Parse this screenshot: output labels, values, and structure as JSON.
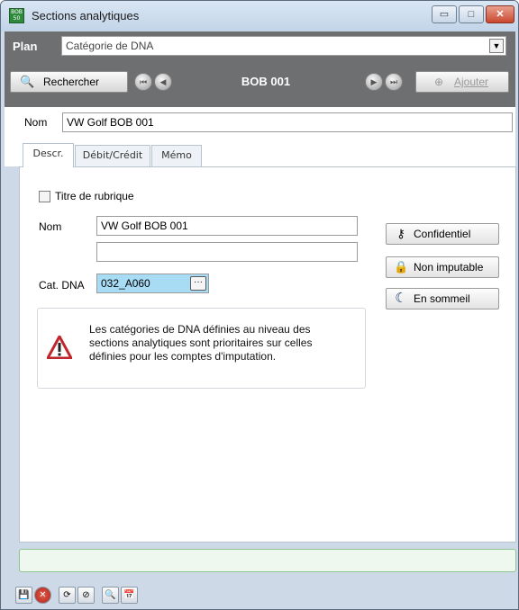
{
  "window": {
    "title": "Sections analytiques",
    "app_badge": "BOB 50"
  },
  "caption_buttons": {
    "minimize": "▭",
    "maximize": "□",
    "close": "✕"
  },
  "header": {
    "plan_label": "Plan",
    "plan_value": "Catégorie de DNA",
    "search_button": "Rechercher",
    "record_title": "BOB 001",
    "add_button": "Ajouter"
  },
  "record": {
    "nom_label": "Nom",
    "nom_value": "VW Golf BOB 001"
  },
  "tabs": [
    {
      "label": "Descr.",
      "active": true
    },
    {
      "label": "Débit/Crédit",
      "active": false
    },
    {
      "label": "Mémo",
      "active": false
    }
  ],
  "descr": {
    "title_checkbox_label": "Titre de rubrique",
    "title_checked": false,
    "nom_label": "Nom",
    "nom_value": "VW Golf BOB 001",
    "nom2_value": "",
    "cat_label": "Cat. DNA",
    "cat_value": "032_A060",
    "ellipsis": "···",
    "side_buttons": {
      "confidential": "Confidentiel",
      "non_imputable": "Non imputable",
      "dormant": "En sommeil"
    },
    "warning_text": "Les catégories de DNA définies au niveau des sections analytiques sont prioritaires sur celles définies pour les comptes d'imputation."
  },
  "colors": {
    "header_band": "#6d6f71",
    "focused_field": "#a8dcf5",
    "status_border": "#8cc490",
    "warning_red": "#c0272d"
  }
}
